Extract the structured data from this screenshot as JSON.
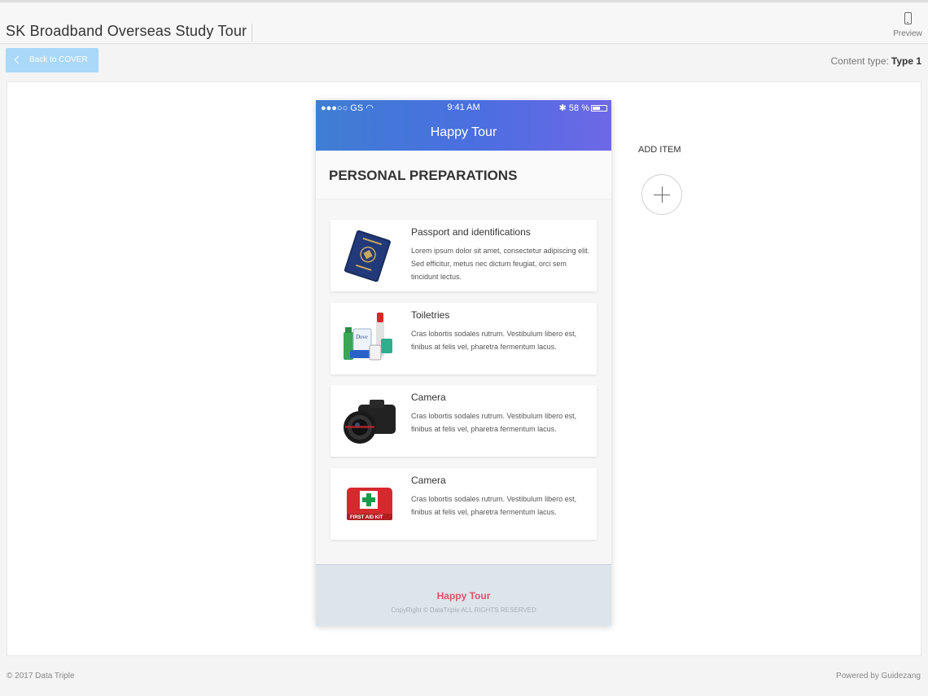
{
  "header": {
    "app_title": "SK Broadband Overseas Study Tour",
    "preview_label": "Preview",
    "preview_icon": "smartphone-icon"
  },
  "toolbar": {
    "back_label": "Back to COVER",
    "back_icon": "chevron-left-icon",
    "content_type_label": "Content type:",
    "content_type_value": "Type 1"
  },
  "phone": {
    "status": {
      "carrier": "●●●○○ GS",
      "time": "9:41 AM",
      "battery": "58 %"
    },
    "app_title": "Happy Tour",
    "section_title": "PERSONAL PREPARATIONS",
    "items": [
      {
        "title": "Passport and identifications",
        "text": "Lorem ipsum dolor sit amet, consectetur adipiscing elit. Sed efficitur, metus nec dictum feugiat, orci sem tincidunt lectus.",
        "icon": "passport-icon"
      },
      {
        "title": "Toiletries",
        "text": "Cras lobortis sodales rutrum. Vestibulum libero est, finibus at felis vel, pharetra fermentum lacus.",
        "icon": "toiletries-icon"
      },
      {
        "title": "Camera",
        "text": "Cras lobortis sodales rutrum. Vestibulum libero est, finibus at felis vel, pharetra fermentum lacus.",
        "icon": "camera-icon"
      },
      {
        "title": "Camera",
        "text": "Cras lobortis sodales rutrum. Vestibulum libero est, finibus at felis vel, pharetra fermentum lacus.",
        "icon": "first-aid-kit-icon"
      }
    ],
    "footer": {
      "brand": "Happy Tour",
      "copyright": "CopyRight © DataTriple ALL RIGHTS RESERVED"
    }
  },
  "add_item": {
    "label": "ADD ITEM",
    "icon": "plus-icon"
  },
  "page_footer": {
    "left": "© 2017 Data Triple",
    "right": "Powered by Guidezang"
  },
  "colors": {
    "accent_light_blue": "#a9d8f8",
    "header_gradient_start": "#3f7ed3",
    "header_gradient_end": "#6e68e6",
    "brand_pink": "#e0526a"
  }
}
